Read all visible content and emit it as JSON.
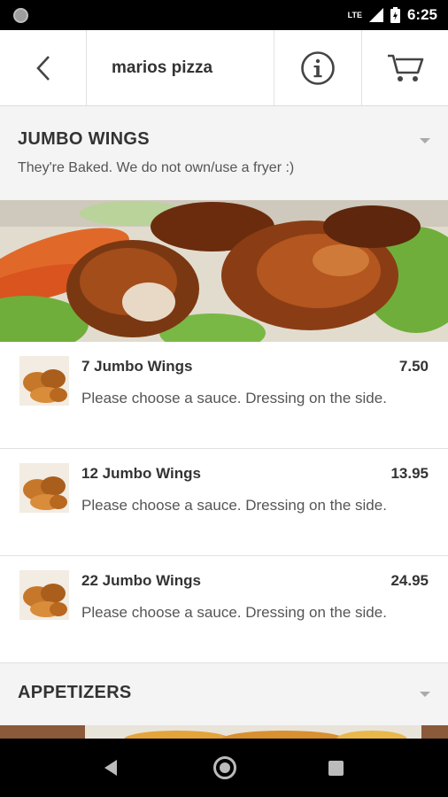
{
  "status_bar": {
    "time": "6:25",
    "network": "LTE"
  },
  "toolbar": {
    "title": "marios pizza"
  },
  "sections": [
    {
      "name": "JUMBO WINGS",
      "description": "They're Baked. We do not own/use a fryer :)",
      "items": [
        {
          "name": "7 Jumbo Wings",
          "price": "7.50",
          "description": "Please choose a sauce. Dressing on the side."
        },
        {
          "name": "12 Jumbo Wings",
          "price": "13.95",
          "description": "Please choose a sauce. Dressing on the side."
        },
        {
          "name": "22 Jumbo Wings",
          "price": "24.95",
          "description": "Please choose a sauce. Dressing on the side."
        }
      ]
    },
    {
      "name": "APPETIZERS"
    }
  ],
  "colors": {
    "accent_text": "#333333",
    "background": "#eeeeee",
    "status_bar": "#000000"
  }
}
